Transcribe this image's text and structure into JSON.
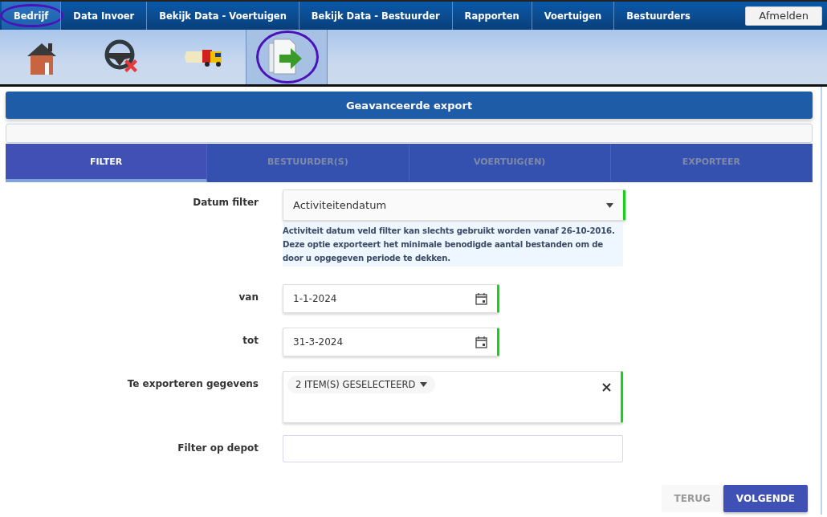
{
  "menu": {
    "items": [
      {
        "label": "Bedrijf",
        "selected": true,
        "circled": true
      },
      {
        "label": "Data Invoer",
        "selected": false,
        "circled": false
      },
      {
        "label": "Bekijk Data - Voertuigen",
        "selected": false,
        "circled": false
      },
      {
        "label": "Bekijk Data - Bestuurder",
        "selected": false,
        "circled": false
      },
      {
        "label": "Rapporten",
        "selected": false,
        "circled": false
      },
      {
        "label": "Voertuigen",
        "selected": false,
        "circled": false
      },
      {
        "label": "Bestuurders",
        "selected": false,
        "circled": false
      }
    ],
    "logout": "Afmelden"
  },
  "toolbar": {
    "items": [
      {
        "kind": "home",
        "selected": false,
        "circled": false
      },
      {
        "kind": "steering",
        "selected": false,
        "circled": false
      },
      {
        "kind": "truck",
        "selected": false,
        "circled": false
      },
      {
        "kind": "export",
        "selected": true,
        "circled": true
      }
    ]
  },
  "panel": {
    "title": "Geavanceerde export"
  },
  "tabs": [
    {
      "label": "FILTER",
      "selected": true
    },
    {
      "label": "BESTUURDER(S)",
      "selected": false
    },
    {
      "label": "VOERTUIG(EN)",
      "selected": false
    },
    {
      "label": "EXPORTEER",
      "selected": false
    }
  ],
  "form": [
    {
      "kind": "select",
      "label": "Datum filter",
      "value": "Activiteitendatum",
      "valid": true,
      "hint": "Activiteit datum veld filter kan slechts gebruikt worden vanaf 26-10-2016. Deze optie exporteert het minimale benodigde aantal bestanden om de door u opgegeven periode te dekken."
    },
    {
      "kind": "date",
      "label": "van",
      "value": "1-1-2024",
      "valid": true
    },
    {
      "kind": "date",
      "label": "tot",
      "value": "31-3-2024",
      "valid": true
    },
    {
      "kind": "multiselect",
      "label": "Te exporteren gegevens",
      "value": "2 ITEM(S) GESELECTEERD",
      "valid": true
    },
    {
      "kind": "text",
      "label": "Filter op depot",
      "valid": false
    }
  ],
  "buttons": [
    {
      "label": "TERUG",
      "primary": false
    },
    {
      "label": "VOLGENDE",
      "primary": true
    }
  ]
}
